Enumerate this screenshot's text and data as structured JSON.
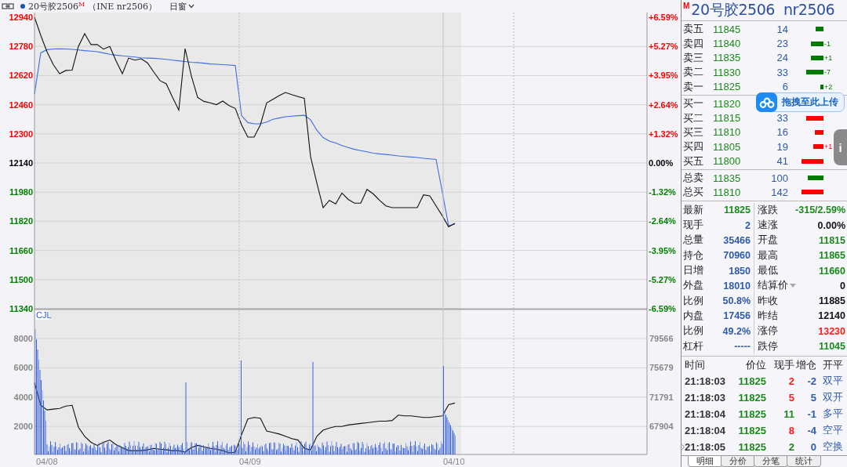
{
  "toolbar": {
    "symbol": "20号胶2506",
    "badge": "M",
    "exchange": "（INE nr2506）",
    "period": "日窗"
  },
  "chart": {
    "chart_data": {
      "type": "line",
      "grid": true,
      "ylim": [
        11340,
        12966
      ],
      "yticks": [
        {
          "value": 12940,
          "label": "12940"
        },
        {
          "value": 12780,
          "label": "12780"
        },
        {
          "value": 12620,
          "label": "12620"
        },
        {
          "value": 12460,
          "label": "12460"
        },
        {
          "value": 12300,
          "label": "12300"
        },
        {
          "value": 11980,
          "label": "11980"
        },
        {
          "value": 11500,
          "label": "11500"
        },
        {
          "value": 11340,
          "label": "11340"
        }
      ],
      "categories": [
        null,
        null,
        null,
        null,
        null,
        null,
        null,
        null,
        null,
        null,
        null,
        null,
        null,
        null,
        null,
        null,
        null,
        null,
        null,
        null,
        null,
        null,
        null,
        null,
        null,
        null,
        null,
        null,
        null,
        null,
        null,
        null,
        null,
        null,
        null,
        null,
        null,
        null,
        null,
        null,
        null,
        null,
        null,
        null,
        null,
        null,
        null,
        null,
        null,
        null,
        null,
        null,
        null,
        null,
        null,
        null,
        null,
        null,
        null,
        null,
        null,
        null,
        null,
        null,
        null,
        null,
        null,
        null
      ],
      "series": [
        {
          "color": "#111111",
          "values": [
            12940,
            12840,
            12750,
            12680,
            12630,
            12648,
            12650,
            12780,
            12850,
            12790,
            12790,
            12765,
            12780,
            12700,
            12630,
            12716,
            12705,
            12712,
            12690,
            12640,
            12592,
            12575,
            12500,
            12430,
            12768,
            12618,
            12500,
            12478,
            12470,
            12460,
            12480,
            12455,
            12440,
            12350,
            12282,
            12282,
            12350,
            12470,
            12490,
            12510,
            12527,
            12515,
            12505,
            12495,
            12175,
            12030,
            11895,
            11935,
            11915,
            11975,
            11940,
            11920,
            11920,
            11995,
            11970,
            11935,
            11905,
            11895,
            11895,
            11895,
            11895,
            11895,
            11965,
            11960,
            11905,
            11850,
            11790,
            11809
          ]
        },
        {
          "color": "#3f6fe0",
          "values": [
            12519,
            12745,
            12762,
            12766,
            12767,
            12766,
            12764,
            12761,
            12757,
            12754,
            12751,
            12744,
            12737,
            12732,
            12728,
            12725,
            12722,
            12718,
            12716,
            12715,
            12712,
            12709,
            12705,
            12701,
            12697,
            12693,
            12691,
            12688,
            12684,
            12682,
            12680,
            12678,
            12675,
            12400,
            12362,
            12355,
            12355,
            12365,
            12380,
            12387,
            12394,
            12397,
            12400,
            12402,
            12377,
            12320,
            12280,
            12260,
            12250,
            12236,
            12225,
            12215,
            12208,
            12201,
            12194,
            12190,
            12187,
            12183,
            12179,
            12176,
            12173,
            12170,
            12166,
            12163,
            12160,
            11980,
            11795,
            11805
          ]
        }
      ]
    },
    "price_axis": [
      {
        "color": "#ff0000"
      },
      {
        "color": "#ff0000"
      },
      {
        "color": "#ff0000"
      },
      {
        "color": "#ff0000"
      },
      {
        "color": "#ff0000"
      },
      {
        "label": "12140",
        "color": "#000000"
      },
      {
        "color": "#008000"
      },
      {
        "label": "11820",
        "color": "#008000"
      },
      {
        "label": "11660",
        "color": "#008000"
      },
      {
        "color": "#008000"
      },
      {
        "color": "#008000"
      }
    ],
    "dates": [
      "04/08",
      "04/09",
      "04/10"
    ],
    "percent_axis": [
      {
        "label": "+6.59%",
        "color": "#ff0000"
      },
      {
        "label": "+5.27%",
        "color": "#ff0000"
      },
      {
        "label": "+3.95%",
        "color": "#ff0000"
      },
      {
        "label": "+2.64%",
        "color": "#ff0000"
      },
      {
        "label": "+1.32%",
        "color": "#ff0000"
      },
      {
        "label": "0.00%",
        "color": "#000000"
      },
      {
        "label": "-1.32%",
        "color": "#008000"
      },
      {
        "label": "-2.64%",
        "color": "#008000"
      },
      {
        "label": "-3.95%",
        "color": "#008000"
      },
      {
        "label": "-5.27%",
        "color": "#008000"
      },
      {
        "label": "-6.59%",
        "color": "#008000"
      }
    ],
    "volume_pane": {
      "label": "CJL",
      "volume_axis": [
        "8000",
        "6000",
        "4000",
        "2000"
      ],
      "chart_data": {
        "type": "line",
        "grid": true,
        "ylim": [
          64190,
          83460
        ],
        "yticks": [
          {
            "value": 79566,
            "label": "79566"
          },
          {
            "value": 75679,
            "label": "75679"
          },
          {
            "value": 71791,
            "label": "71791"
          },
          {
            "value": 67904,
            "label": "67904"
          }
        ],
        "categories": [
          null,
          null,
          null,
          null,
          null,
          null,
          null,
          null,
          null,
          null,
          null,
          null,
          null,
          null,
          null,
          null,
          null,
          null,
          null,
          null,
          null,
          null,
          null,
          null,
          null,
          null,
          null,
          null,
          null,
          null,
          null,
          null,
          null,
          null,
          null,
          null,
          null,
          null,
          null,
          null,
          null,
          null,
          null,
          null,
          null,
          null,
          null,
          null,
          null,
          null,
          null,
          null,
          null,
          null,
          null,
          null,
          null,
          null,
          null,
          null,
          null,
          null,
          null,
          null,
          null,
          null,
          null,
          null
        ],
        "series": [
          {
            "color": "#111111",
            "values": [
              73700,
              70700,
              70100,
              70200,
              70300,
              70600,
              70700,
              67800,
              66600,
              65800,
              65400,
              65800,
              66100,
              65500,
              65100,
              64700,
              64700,
              64700,
              64800,
              65000,
              64900,
              64800,
              64700,
              64700,
              64500,
              65100,
              65400,
              65200,
              65000,
              64900,
              64700,
              64400,
              64500,
              66800,
              68900,
              69100,
              69000,
              67300,
              67100,
              66900,
              66600,
              66300,
              66100,
              65000,
              64800,
              66600,
              67400,
              67700,
              67900,
              67900,
              68100,
              68200,
              68300,
              68400,
              68500,
              68600,
              68600,
              68700,
              69400,
              69300,
              69300,
              69200,
              69100,
              69100,
              69200,
              69300,
              70800,
              71000
            ]
          }
        ]
      }
    }
  },
  "quote": {
    "badge": "M",
    "title": "20号胶2506  nr2506",
    "book": [
      {
        "label": "卖五",
        "price": "11845",
        "volume": "14",
        "color": "#007a00"
      },
      {
        "label": "卖四",
        "price": "11840",
        "volume": "23",
        "color": "#007a00",
        "change": "-1"
      },
      {
        "label": "卖三",
        "price": "11835",
        "volume": "24",
        "color": "#007a00",
        "change": "+1"
      },
      {
        "label": "卖二",
        "price": "11830",
        "volume": "33",
        "color": "#007a00",
        "change": "-7"
      },
      {
        "label": "卖一",
        "price": "11825",
        "volume": "6",
        "color": "#007a00",
        "change": "+2"
      },
      {
        "label": "买一",
        "price": "11820"
      },
      {
        "label": "买二",
        "price": "11815",
        "volume": "33",
        "color": "#ff0000"
      },
      {
        "label": "买三",
        "price": "11810",
        "volume": "16",
        "color": "#ff0000"
      },
      {
        "label": "买四",
        "price": "11805",
        "volume": "19",
        "color": "#ff0000",
        "change": "+1"
      },
      {
        "label": "买五",
        "price": "11800",
        "volume": "41",
        "color": "#ff0000"
      }
    ],
    "totals": [
      {
        "label": "总卖",
        "price": "11835",
        "volume": "100",
        "color": "#007a00"
      },
      {
        "label": "总买",
        "price": "11810",
        "volume": "142",
        "color": "#ff0000"
      }
    ],
    "stats": [
      {
        "left": {
          "label": "最新",
          "value": "11825",
          "color": "#1a8a1a"
        },
        "right": {
          "label": "涨跌",
          "value": "-315/2.59%",
          "color": "#1a8a1a"
        }
      },
      {
        "left": {
          "label": "现手",
          "value": "2",
          "color": "#2f5aa8"
        },
        "right": {
          "label": "速涨",
          "value": "0.00%",
          "color": "#111111"
        }
      },
      {
        "left": {
          "label": "总量",
          "value": "35466",
          "color": "#2f5aa8"
        },
        "right": {
          "label": "开盘",
          "value": "11815",
          "color": "#1a8a1a"
        }
      },
      {
        "left": {
          "label": "持仓",
          "value": "70960",
          "color": "#2f5aa8"
        },
        "right": {
          "label": "最高",
          "value": "11865",
          "color": "#1a8a1a"
        }
      },
      {
        "left": {
          "label": "日增",
          "value": "1850",
          "color": "#2f5aa8"
        },
        "right": {
          "label": "最低",
          "value": "11660",
          "color": "#1a8a1a"
        }
      },
      {
        "left": {
          "label": "外盘",
          "value": "18010",
          "color": "#2f5aa8"
        },
        "right": {
          "label": "结算价",
          "value": "0",
          "color": "#111111",
          "dropdown": true
        }
      },
      {
        "left": {
          "label": "比例",
          "value": "50.8%",
          "color": "#2f5aa8"
        },
        "right": {
          "label": "昨收",
          "value": "11885",
          "color": "#111111"
        }
      },
      {
        "left": {
          "label": "内盘",
          "value": "17456",
          "color": "#2f5aa8"
        },
        "right": {
          "label": "昨结",
          "value": "12140",
          "color": "#111111"
        }
      },
      {
        "left": {
          "label": "比例",
          "value": "49.2%",
          "color": "#2f5aa8"
        },
        "right": {
          "label": "涨停",
          "value": "13230",
          "color": "#ff1a1a"
        }
      },
      {
        "left": {
          "label": "杠杆",
          "value": "-----",
          "color": "#2f5aa8"
        },
        "right": {
          "label": "跌停",
          "value": "11045",
          "color": "#1a8a1a"
        }
      }
    ],
    "trades": {
      "columns": [
        "时间",
        "价位",
        "现手",
        "增仓",
        "开平"
      ],
      "rows": [
        {
          "time": "21:18:03",
          "price": "11825",
          "hand": "2",
          "color": "#ff1a1a",
          "change": "-2",
          "type": "双平",
          "selected": false
        },
        {
          "time": "21:18:03",
          "price": "11825",
          "hand": "5",
          "color": "#ff1a1a",
          "change": "5",
          "type": "双开",
          "selected": false
        },
        {
          "time": "21:18:04",
          "price": "11825",
          "hand": "11",
          "color": "#1a8a1a",
          "change": "-1",
          "type": "多平",
          "selected": false
        },
        {
          "time": "21:18:04",
          "price": "11825",
          "hand": "8",
          "color": "#ff1a1a",
          "change": "-4",
          "type": "空平",
          "selected": false
        },
        {
          "time": "21:18:05",
          "price": "11825",
          "hand": "2",
          "color": "#1a8a1a",
          "change": "0",
          "type": "空换",
          "selected": true
        }
      ]
    },
    "tabs": [
      {
        "label": "明细",
        "selected": true
      },
      {
        "label": "分价",
        "selected": false
      },
      {
        "label": "分笔",
        "selected": false
      },
      {
        "label": "统计",
        "selected": false
      }
    ]
  },
  "upload_button": {
    "label": "拖拽至此上传"
  },
  "side_tab": {
    "label": "i"
  }
}
